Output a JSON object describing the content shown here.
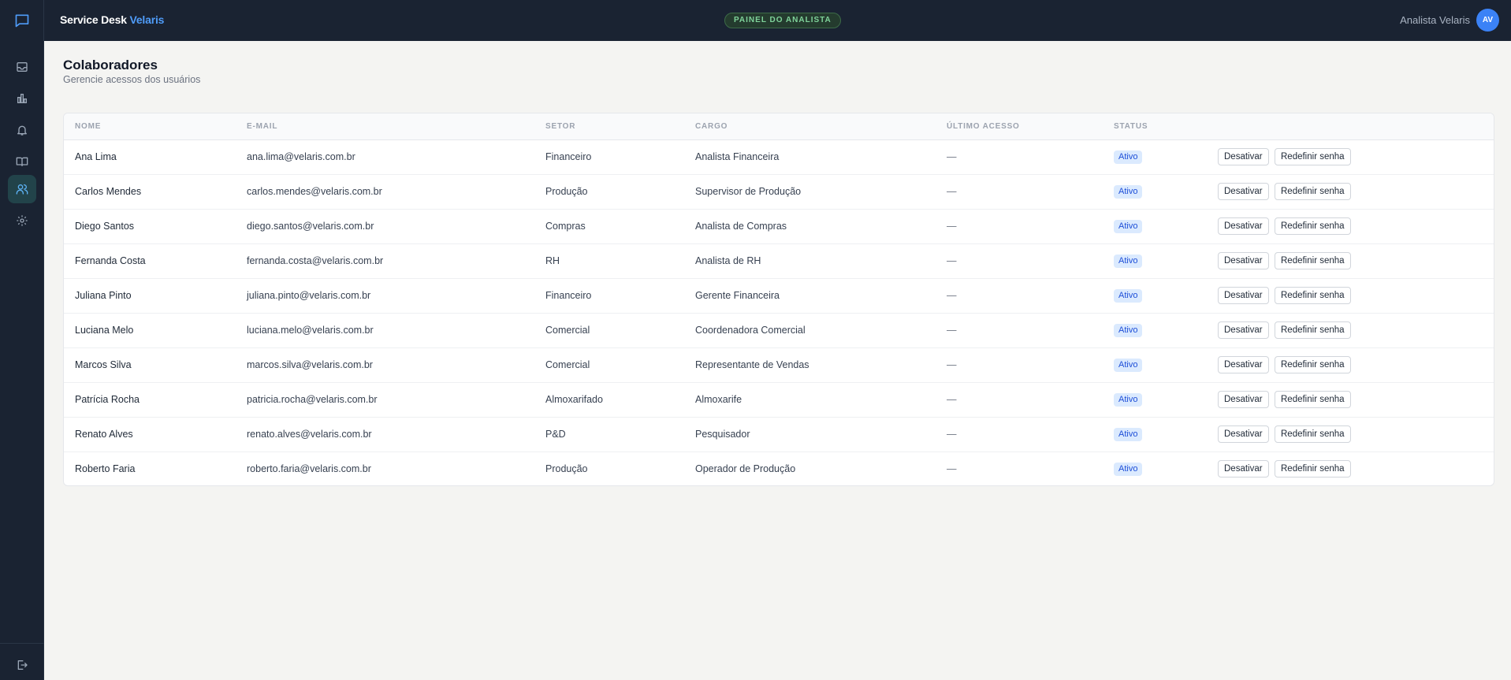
{
  "header": {
    "brand_prefix": "Service Desk",
    "brand_accent": "Velaris",
    "panel_badge": "PAINEL DO ANALISTA",
    "user_name": "Analista Velaris",
    "avatar_initials": "AV"
  },
  "sidebar": {
    "items": [
      {
        "icon": "inbox-icon",
        "active": false
      },
      {
        "icon": "bar-chart-icon",
        "active": false
      },
      {
        "icon": "bell-icon",
        "active": false
      },
      {
        "icon": "book-icon",
        "active": false
      },
      {
        "icon": "users-icon",
        "active": true
      },
      {
        "icon": "gear-icon",
        "active": false
      }
    ],
    "logout_icon": "logout-icon"
  },
  "page": {
    "title": "Colaboradores",
    "subtitle": "Gerencie acessos dos usuários"
  },
  "table": {
    "columns": [
      "NOME",
      "E-MAIL",
      "SETOR",
      "CARGO",
      "ÚLTIMO ACESSO",
      "STATUS"
    ],
    "action_labels": {
      "deactivate": "Desativar",
      "reset": "Redefinir senha"
    },
    "rows": [
      {
        "name": "Ana Lima",
        "email": "ana.lima@velaris.com.br",
        "sector": "Financeiro",
        "role": "Analista Financeira",
        "last_access": "—",
        "status": "Ativo"
      },
      {
        "name": "Carlos Mendes",
        "email": "carlos.mendes@velaris.com.br",
        "sector": "Produção",
        "role": "Supervisor de Produção",
        "last_access": "—",
        "status": "Ativo"
      },
      {
        "name": "Diego Santos",
        "email": "diego.santos@velaris.com.br",
        "sector": "Compras",
        "role": "Analista de Compras",
        "last_access": "—",
        "status": "Ativo"
      },
      {
        "name": "Fernanda Costa",
        "email": "fernanda.costa@velaris.com.br",
        "sector": "RH",
        "role": "Analista de RH",
        "last_access": "—",
        "status": "Ativo"
      },
      {
        "name": "Juliana Pinto",
        "email": "juliana.pinto@velaris.com.br",
        "sector": "Financeiro",
        "role": "Gerente Financeira",
        "last_access": "—",
        "status": "Ativo"
      },
      {
        "name": "Luciana Melo",
        "email": "luciana.melo@velaris.com.br",
        "sector": "Comercial",
        "role": "Coordenadora Comercial",
        "last_access": "—",
        "status": "Ativo"
      },
      {
        "name": "Marcos Silva",
        "email": "marcos.silva@velaris.com.br",
        "sector": "Comercial",
        "role": "Representante de Vendas",
        "last_access": "—",
        "status": "Ativo"
      },
      {
        "name": "Patrícia Rocha",
        "email": "patricia.rocha@velaris.com.br",
        "sector": "Almoxarifado",
        "role": "Almoxarife",
        "last_access": "—",
        "status": "Ativo"
      },
      {
        "name": "Renato Alves",
        "email": "renato.alves@velaris.com.br",
        "sector": "P&D",
        "role": "Pesquisador",
        "last_access": "—",
        "status": "Ativo"
      },
      {
        "name": "Roberto Faria",
        "email": "roberto.faria@velaris.com.br",
        "sector": "Produção",
        "role": "Operador de Produção",
        "last_access": "—",
        "status": "Ativo"
      }
    ]
  },
  "colors": {
    "sidebar_bg": "#1a2332",
    "accent": "#4f9cf9",
    "status_bg": "#dbeafe",
    "status_text": "#1d4ed8"
  }
}
